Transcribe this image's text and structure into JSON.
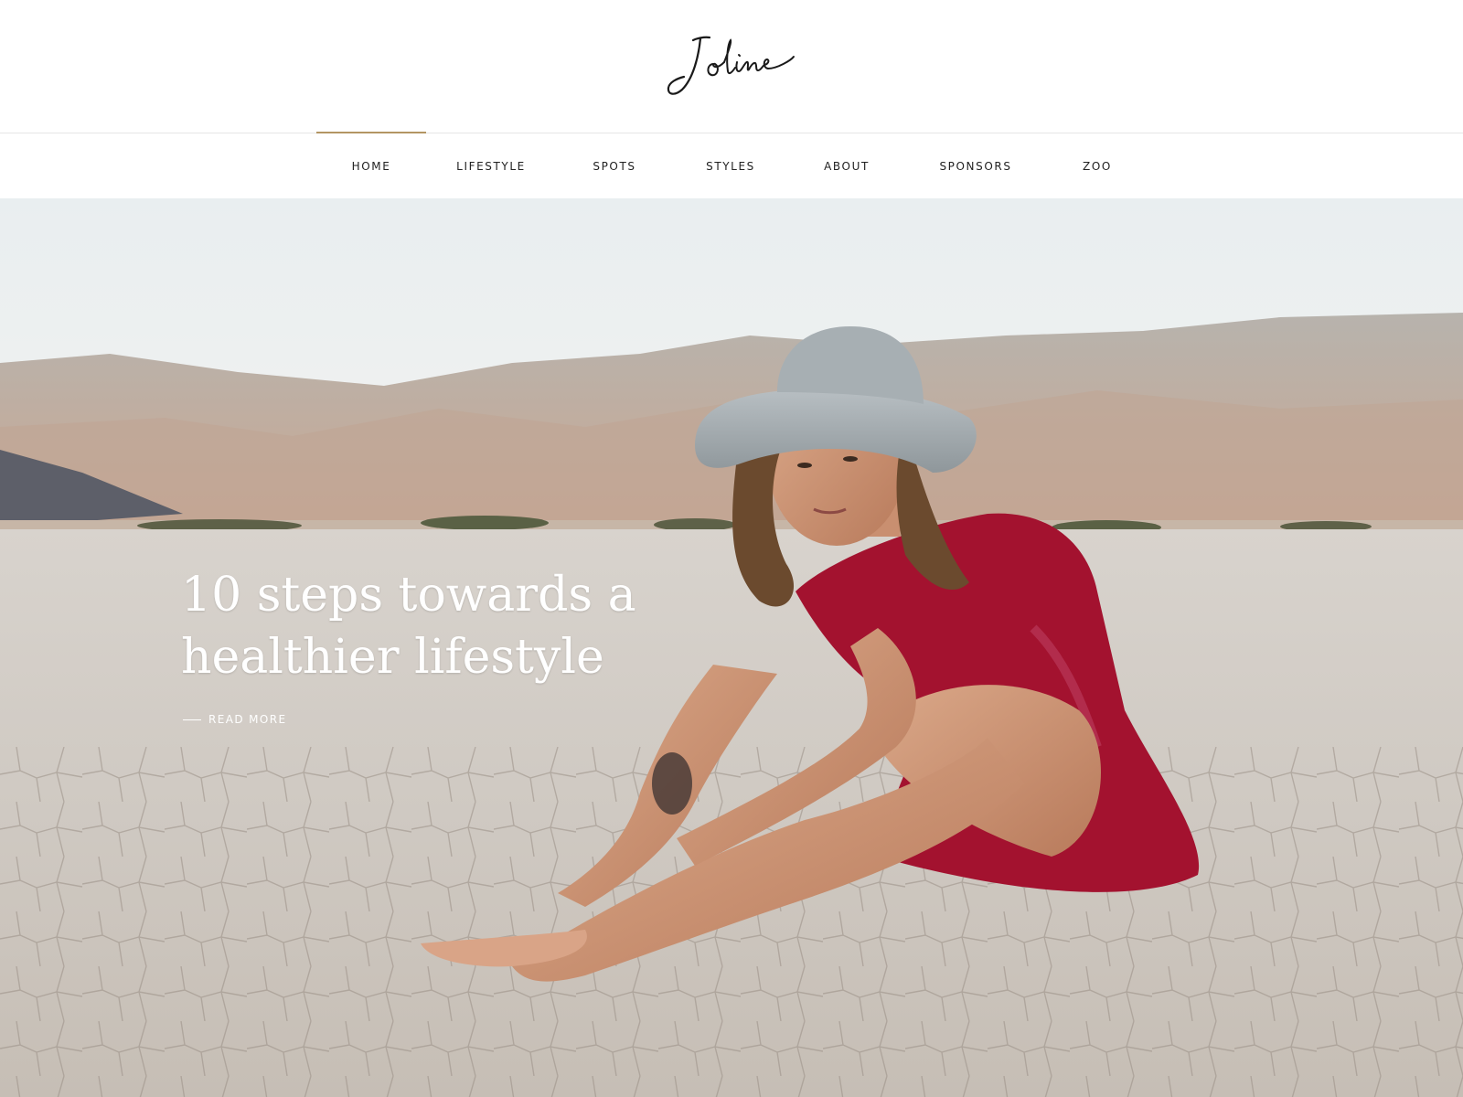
{
  "brand": {
    "logo_text": "Joline"
  },
  "nav": {
    "items": [
      {
        "label": "HOME",
        "active": true
      },
      {
        "label": "LIFESTYLE"
      },
      {
        "label": "SPOTS"
      },
      {
        "label": "STYLES"
      },
      {
        "label": "ABOUT"
      },
      {
        "label": "SPONSORS"
      },
      {
        "label": "ZOO"
      }
    ]
  },
  "hero": {
    "title_line1": "10 steps towards a",
    "title_line2": "healthier lifestyle",
    "read_more": "READ MORE"
  },
  "colors": {
    "accent": "#b39563",
    "text": "#222222",
    "hero_text": "#ffffff",
    "dress": "#a3122f"
  }
}
